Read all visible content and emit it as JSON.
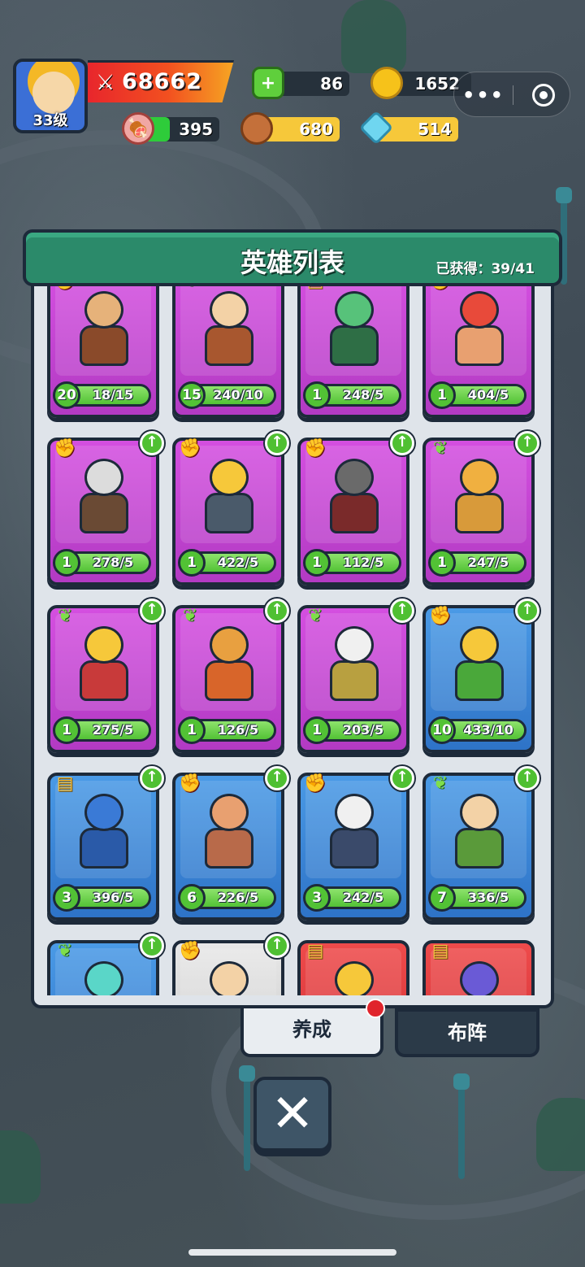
{
  "player": {
    "level_label": "33级",
    "power": "68662"
  },
  "resources": {
    "gems": "86",
    "gold": "1652",
    "meat": "395",
    "wood": "680",
    "crystal": "514"
  },
  "panel": {
    "title": "英雄列表",
    "obtained_label": "已获得：39/41"
  },
  "heroes": [
    {
      "color": "purple",
      "cls": "str",
      "level": "20",
      "frag": "18/15",
      "up": false,
      "fill": 1.0,
      "head": "#e6b27a",
      "body": "#8a4a2a"
    },
    {
      "color": "purple",
      "cls": "agi",
      "level": "15",
      "frag": "240/10",
      "up": false,
      "fill": 1.0,
      "head": "#f3d2a6",
      "body": "#a8572f"
    },
    {
      "color": "purple",
      "cls": "int",
      "level": "1",
      "frag": "248/5",
      "up": false,
      "fill": 1.0,
      "head": "#57c27a",
      "body": "#2e6e45"
    },
    {
      "color": "purple",
      "cls": "str",
      "level": "1",
      "frag": "404/5",
      "up": false,
      "fill": 1.0,
      "head": "#e84a3a",
      "body": "#e8a070"
    },
    {
      "color": "purple",
      "cls": "str",
      "level": "1",
      "frag": "278/5",
      "up": true,
      "fill": 1.0,
      "head": "#dcdcdc",
      "body": "#6a4a34"
    },
    {
      "color": "purple",
      "cls": "str",
      "level": "1",
      "frag": "422/5",
      "up": true,
      "fill": 1.0,
      "head": "#f6c83a",
      "body": "#4a5a6a"
    },
    {
      "color": "purple",
      "cls": "str",
      "level": "1",
      "frag": "112/5",
      "up": true,
      "fill": 1.0,
      "head": "#6a6a6a",
      "body": "#7a2a2a"
    },
    {
      "color": "purple",
      "cls": "agi",
      "level": "1",
      "frag": "247/5",
      "up": true,
      "fill": 1.0,
      "head": "#f0b040",
      "body": "#d89a3a"
    },
    {
      "color": "purple",
      "cls": "agi",
      "level": "1",
      "frag": "275/5",
      "up": true,
      "fill": 1.0,
      "head": "#f6c83a",
      "body": "#c83a3a"
    },
    {
      "color": "purple",
      "cls": "agi",
      "level": "1",
      "frag": "126/5",
      "up": true,
      "fill": 1.0,
      "head": "#e8a040",
      "body": "#d8652a"
    },
    {
      "color": "purple",
      "cls": "agi",
      "level": "1",
      "frag": "203/5",
      "up": true,
      "fill": 1.0,
      "head": "#f0f0f0",
      "body": "#b8a040"
    },
    {
      "color": "blue",
      "cls": "str",
      "level": "10",
      "frag": "433/10",
      "up": true,
      "fill": 1.0,
      "head": "#f6c83a",
      "body": "#4aa83a"
    },
    {
      "color": "blue",
      "cls": "int",
      "level": "3",
      "frag": "396/5",
      "up": true,
      "fill": 1.0,
      "head": "#3a7ad6",
      "body": "#2a5aa8"
    },
    {
      "color": "blue",
      "cls": "str",
      "level": "6",
      "frag": "226/5",
      "up": true,
      "fill": 1.0,
      "head": "#e8a070",
      "body": "#b86a4a"
    },
    {
      "color": "blue",
      "cls": "str",
      "level": "3",
      "frag": "242/5",
      "up": true,
      "fill": 1.0,
      "head": "#f0f0f0",
      "body": "#3a4a6a"
    },
    {
      "color": "blue",
      "cls": "agi",
      "level": "7",
      "frag": "336/5",
      "up": true,
      "fill": 1.0,
      "head": "#f3d2a6",
      "body": "#5a9a3a"
    },
    {
      "color": "blue",
      "cls": "agi",
      "level": "",
      "frag": "",
      "up": true,
      "fill": 0,
      "head": "#5ad6c8",
      "body": "#3a8aa8"
    },
    {
      "color": "gray",
      "cls": "str",
      "level": "",
      "frag": "",
      "up": true,
      "fill": 0,
      "head": "#f3d2a6",
      "body": "#aaaaaa"
    },
    {
      "color": "red",
      "cls": "int",
      "level": "",
      "frag": "",
      "up": false,
      "fill": 0,
      "head": "#f6c83a",
      "body": "#c8302a"
    },
    {
      "color": "red",
      "cls": "int",
      "level": "",
      "frag": "",
      "up": false,
      "fill": 0,
      "head": "#6a5ad6",
      "body": "#c8302a"
    }
  ],
  "tabs": {
    "develop": "养成",
    "formation": "布阵"
  },
  "icons": {
    "power": "crossed-swords-icon",
    "gems": "green-gem-plus-icon",
    "gold": "gold-coin-icon",
    "meat": "meat-icon",
    "wood": "log-icon",
    "crystal": "blue-crystal-icon",
    "class_str": "red-fist-icon",
    "class_agi": "green-leaf-icon",
    "class_int": "book-icon",
    "upgrade": "green-arrow-up-icon",
    "close": "close-x-icon"
  },
  "capsule": {
    "more": "•••"
  },
  "close_glyph": "✕"
}
